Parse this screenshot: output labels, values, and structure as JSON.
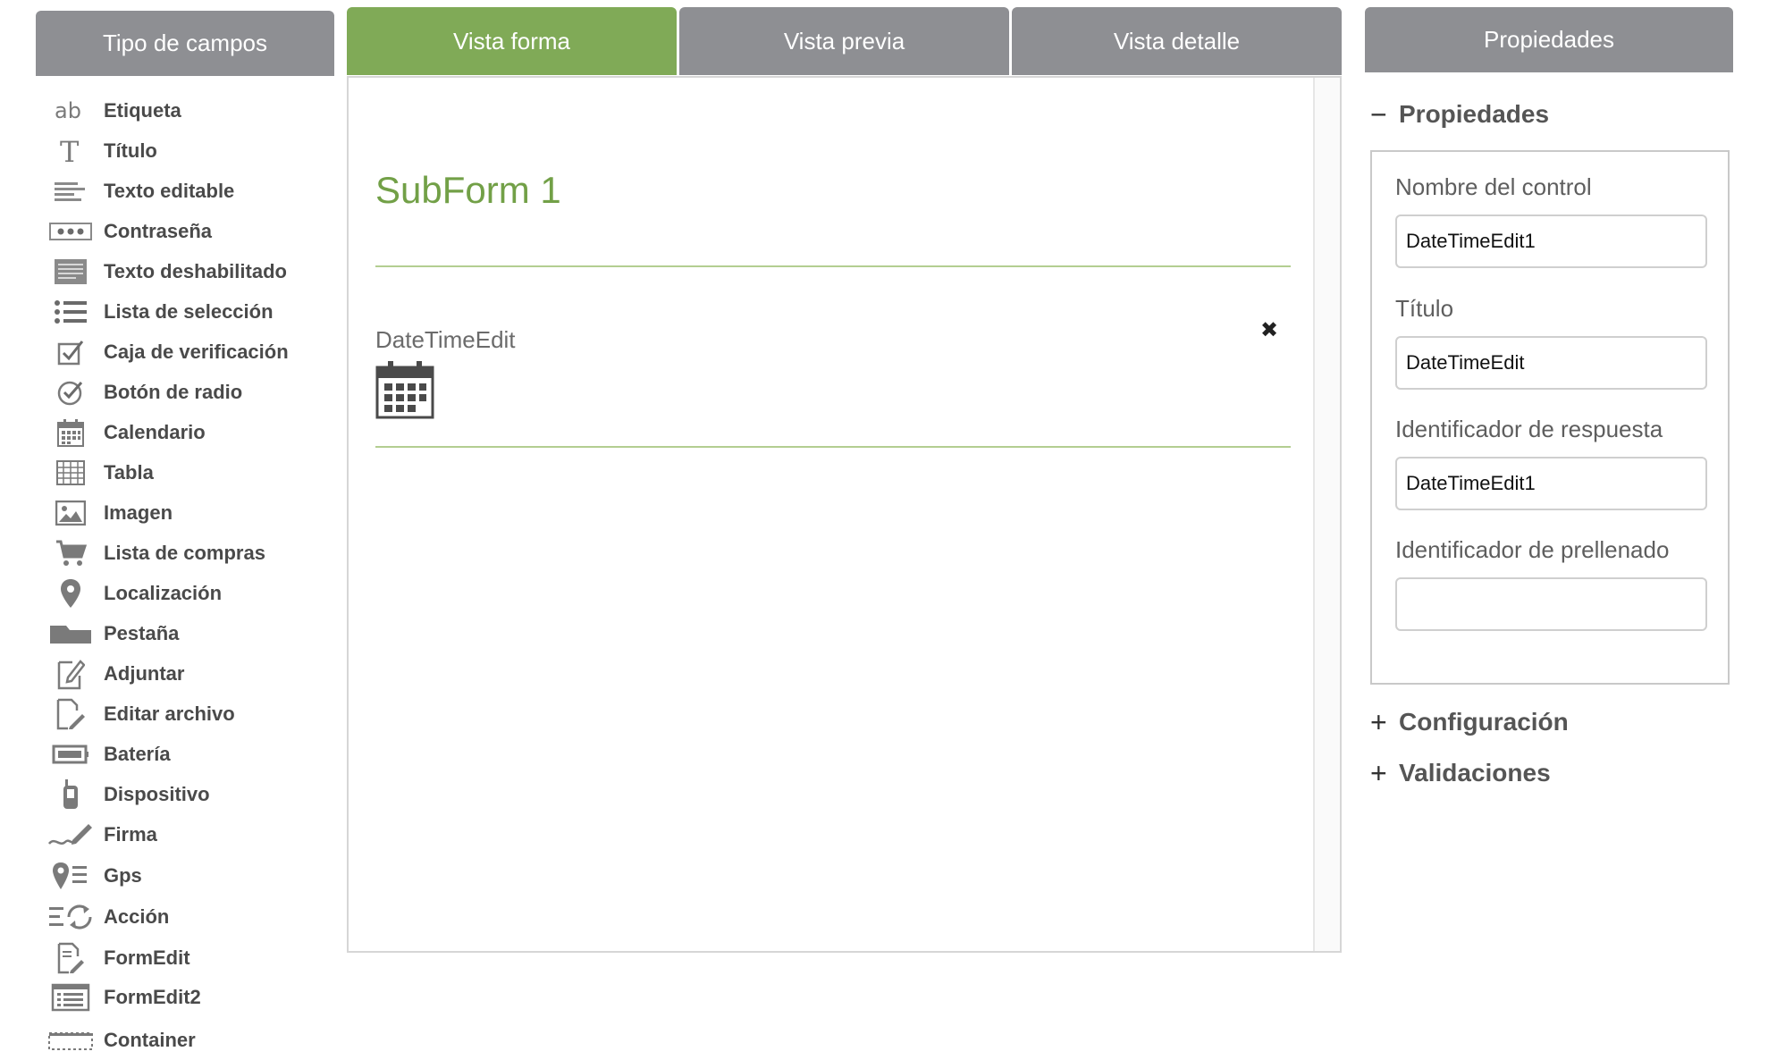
{
  "left_panel": {
    "header": "Tipo de campos",
    "items": [
      {
        "label": "Etiqueta",
        "icon": "label-ab-icon"
      },
      {
        "label": "Título",
        "icon": "title-t-icon"
      },
      {
        "label": "Texto editable",
        "icon": "editable-text-icon"
      },
      {
        "label": "Contraseña",
        "icon": "password-dots-icon"
      },
      {
        "label": "Texto deshabilitado",
        "icon": "disabled-text-icon"
      },
      {
        "label": "Lista de selección",
        "icon": "selection-list-icon"
      },
      {
        "label": "Caja de verificación",
        "icon": "checkbox-icon"
      },
      {
        "label": "Botón de radio",
        "icon": "radio-button-icon"
      },
      {
        "label": "Calendario",
        "icon": "calendar-icon"
      },
      {
        "label": "Tabla",
        "icon": "table-grid-icon"
      },
      {
        "label": "Imagen",
        "icon": "image-icon"
      },
      {
        "label": "Lista de compras",
        "icon": "shopping-cart-icon"
      },
      {
        "label": "Localización",
        "icon": "map-pin-icon"
      },
      {
        "label": "Pestaña",
        "icon": "folder-tab-icon"
      },
      {
        "label": "Adjuntar",
        "icon": "attach-edit-icon"
      },
      {
        "label": "Editar archivo",
        "icon": "edit-file-icon"
      },
      {
        "label": "Batería",
        "icon": "battery-icon"
      },
      {
        "label": "Dispositivo",
        "icon": "device-phone-icon"
      },
      {
        "label": "Firma",
        "icon": "signature-icon"
      },
      {
        "label": "Gps",
        "icon": "gps-list-icon"
      },
      {
        "label": "Acción",
        "icon": "action-sync-icon"
      },
      {
        "label": "FormEdit",
        "icon": "form-edit-icon"
      },
      {
        "label": "FormEdit2",
        "icon": "form-edit2-icon"
      },
      {
        "label": "Container",
        "icon": "container-icon"
      }
    ]
  },
  "tabs": [
    {
      "label": "Vista forma",
      "active": true
    },
    {
      "label": "Vista previa",
      "active": false
    },
    {
      "label": "Vista detalle",
      "active": false
    }
  ],
  "canvas": {
    "subform_title": "SubForm 1",
    "control": {
      "label": "DateTimeEdit",
      "icon": "calendar-icon",
      "remove_icon": "close-x-icon"
    }
  },
  "properties": {
    "header": "Propiedades",
    "section_open": {
      "sign": "−",
      "label": "Propiedades"
    },
    "fields": [
      {
        "label": "Nombre del control",
        "value": "DateTimeEdit1"
      },
      {
        "label": "Título",
        "value": "DateTimeEdit"
      },
      {
        "label": "Identificador de respuesta",
        "value": "DateTimeEdit1"
      },
      {
        "label": "Identificador de prellenado",
        "value": ""
      }
    ],
    "section_config": {
      "sign": "+",
      "label": "Configuración"
    },
    "section_validations": {
      "sign": "+",
      "label": "Validaciones"
    }
  },
  "colors": {
    "header_gray": "#8e8f93",
    "active_green": "#80aa57",
    "title_green": "#72a047",
    "line_green": "#b3ce91"
  }
}
